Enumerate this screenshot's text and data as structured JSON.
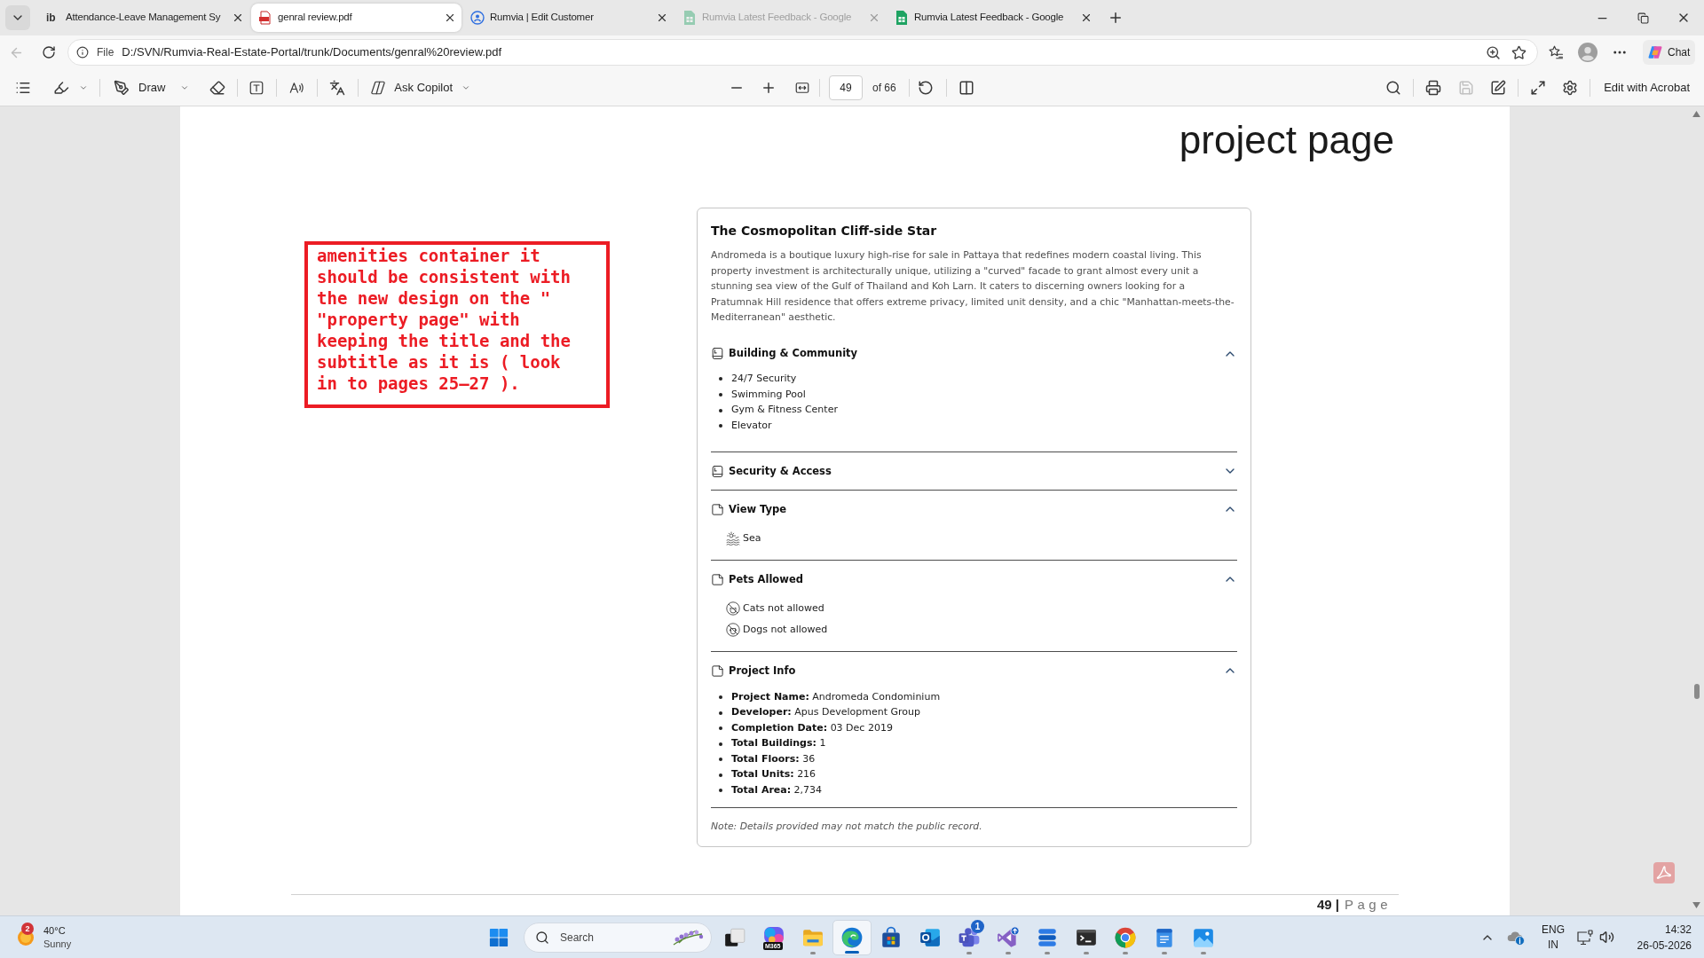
{
  "browser": {
    "tabs": [
      {
        "kind": "logo",
        "logo": "ib",
        "title": "Attendance-Leave Management Sy",
        "selected": false,
        "sleeping": false
      },
      {
        "kind": "pdf",
        "title": "genral review.pdf",
        "selected": true,
        "sleeping": false
      },
      {
        "kind": "site",
        "title": "Rumvia | Edit Customer",
        "selected": false,
        "sleeping": false
      },
      {
        "kind": "sheets",
        "title": "Rumvia Latest Feedback - Google",
        "selected": false,
        "sleeping": true
      },
      {
        "kind": "sheets",
        "title": "Rumvia Latest Feedback - Google",
        "selected": false,
        "sleeping": false
      }
    ],
    "address_bar": {
      "back_disabled": true,
      "scheme": "File",
      "url": "D:/SVN/Rumvia-Real-Estate-Portal/trunk/Documents/genral%20review.pdf"
    },
    "chat_button": "Chat"
  },
  "pdf_toolbar": {
    "draw": "Draw",
    "copilot": "Ask Copilot",
    "page": "49",
    "page_count": "of 66",
    "save_disabled": true,
    "edit": "Edit with Acrobat"
  },
  "page": {
    "heading": "project page",
    "annotation": "amenities container it should be consistent with the new design on the \" \"property page\" with keeping the title and the subtitle as it is ( look in to pages 25–27 ).",
    "card": {
      "title": "The Cosmopolitan Cliff-side Star",
      "description": "Andromeda is a boutique luxury high-rise for sale in Pattaya that redefines modern coastal living. This property investment is architecturally unique, utilizing a \"curved\" facade to grant almost every unit a stunning sea view of the Gulf of Thailand and Koh Larn. It caters to discerning owners looking for a Pratumnak Hill residence that offers extreme privacy, limited unit density, and a chic \"Manhattan-meets-the-Mediterranean\" aesthetic.",
      "sections": [
        {
          "kind": "list",
          "title": "Building & Community",
          "expanded": true,
          "items": [
            "24/7 Security",
            "Swimming Pool",
            "Gym & Fitness Center",
            "Elevator"
          ]
        },
        {
          "kind": "list",
          "title": "Security & Access",
          "expanded": false
        },
        {
          "kind": "icons",
          "title": "View Type",
          "expanded": true,
          "items": [
            {
              "kind": "sea",
              "text": "Sea"
            }
          ]
        },
        {
          "kind": "icons",
          "title": "Pets Allowed",
          "expanded": true,
          "items": [
            {
              "kind": "no-cat",
              "text": "Cats not allowed"
            },
            {
              "kind": "no-dog",
              "text": "Dogs not allowed"
            }
          ]
        },
        {
          "kind": "facts",
          "title": "Project Info",
          "expanded": true,
          "items": [
            {
              "label": "Project Name:",
              "value": "Andromeda Condominium"
            },
            {
              "label": "Developer:",
              "value": "Apus Development Group"
            },
            {
              "label": "Completion Date:",
              "value": "03 Dec 2019"
            },
            {
              "label": "Total Buildings:",
              "value": "1"
            },
            {
              "label": "Total Floors:",
              "value": "36"
            },
            {
              "label": "Total Units:",
              "value": "216"
            },
            {
              "label": "Total Area:",
              "value": "2,734"
            }
          ]
        }
      ],
      "note": "Note: Details provided may not match the public record."
    },
    "footer": {
      "number": "49 |",
      "label": "Page"
    }
  },
  "taskbar": {
    "weather": {
      "badge": "2",
      "temp": "40°C",
      "condition": "Sunny"
    },
    "search": "Search",
    "apps": [
      {
        "kind": "task-view",
        "running": false,
        "active": false
      },
      {
        "kind": "m365",
        "running": false,
        "active": false,
        "label": "M365"
      },
      {
        "kind": "explorer",
        "running": true,
        "active": false
      },
      {
        "kind": "edge",
        "running": true,
        "active": true
      },
      {
        "kind": "store",
        "running": false,
        "active": false
      },
      {
        "kind": "outlook",
        "running": false,
        "active": false
      },
      {
        "kind": "teams",
        "running": true,
        "active": false,
        "badge": "1"
      },
      {
        "kind": "visual-studio",
        "running": true,
        "active": false
      },
      {
        "kind": "stripes",
        "running": true,
        "active": false
      },
      {
        "kind": "terminal",
        "running": true,
        "active": false
      },
      {
        "kind": "chrome",
        "running": true,
        "active": false
      },
      {
        "kind": "notepad",
        "running": true,
        "active": false
      },
      {
        "kind": "photos",
        "running": true,
        "active": false
      }
    ],
    "tray": {
      "language": "ENG",
      "region": "IN",
      "time": "14:32",
      "date": "26-05-2026"
    }
  }
}
